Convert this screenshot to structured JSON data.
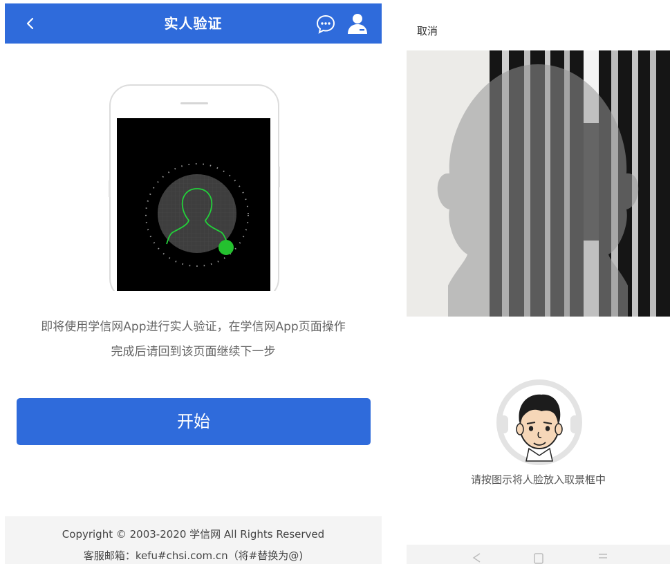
{
  "left_screen": {
    "header": {
      "title": "实人验证",
      "back_icon": "chevron-left-icon",
      "chat_icon": "chat-bubble-icon",
      "user_icon": "user-icon"
    },
    "illustration_icon": "phone-face-scan-illustration",
    "instruction_lines": [
      "即将使用学信网App进行实人验证，在学信网App页面操作",
      "完成后请回到该页面继续下一步"
    ],
    "start_button_label": "开始",
    "footer": {
      "copyright": "Copyright © 2003-2020 学信网 All Rights Reserved",
      "contact": "客服邮箱：kefu#chsi.com.cn（将#替换为@)"
    }
  },
  "right_screen": {
    "cancel_label": "取消",
    "hint_text": "请按图示将人脸放入取景框中",
    "avatar_icon": "face-avatar-icon",
    "nav_icons": [
      "back-triangle-icon",
      "home-square-icon",
      "menu-lines-icon"
    ]
  },
  "colors": {
    "accent": "#2f6bdb",
    "footer_bg": "#f4f4f4",
    "text_muted": "#666666"
  }
}
